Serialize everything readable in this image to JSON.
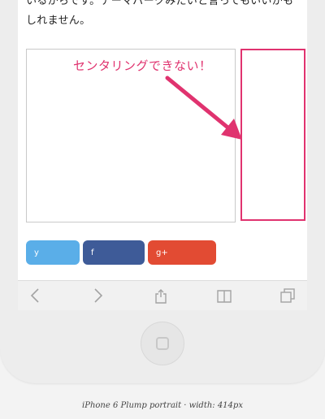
{
  "article": {
    "text": "いるからです。テーマパークみたいと言ってもいいかもしれません。"
  },
  "annotation": {
    "label": "センタリングできない！"
  },
  "share": {
    "twitter": "y",
    "facebook": "f",
    "google_plus": "g+"
  },
  "caption": "iPhone 6 Plump portrait · width: 414px",
  "colors": {
    "annotation": "#e0336f",
    "twitter": "#5aaee8",
    "facebook": "#3e5b98",
    "google_plus": "#e24b33"
  },
  "icons": [
    "back-icon",
    "forward-icon",
    "share-icon",
    "bookmarks-icon",
    "tabs-icon"
  ]
}
